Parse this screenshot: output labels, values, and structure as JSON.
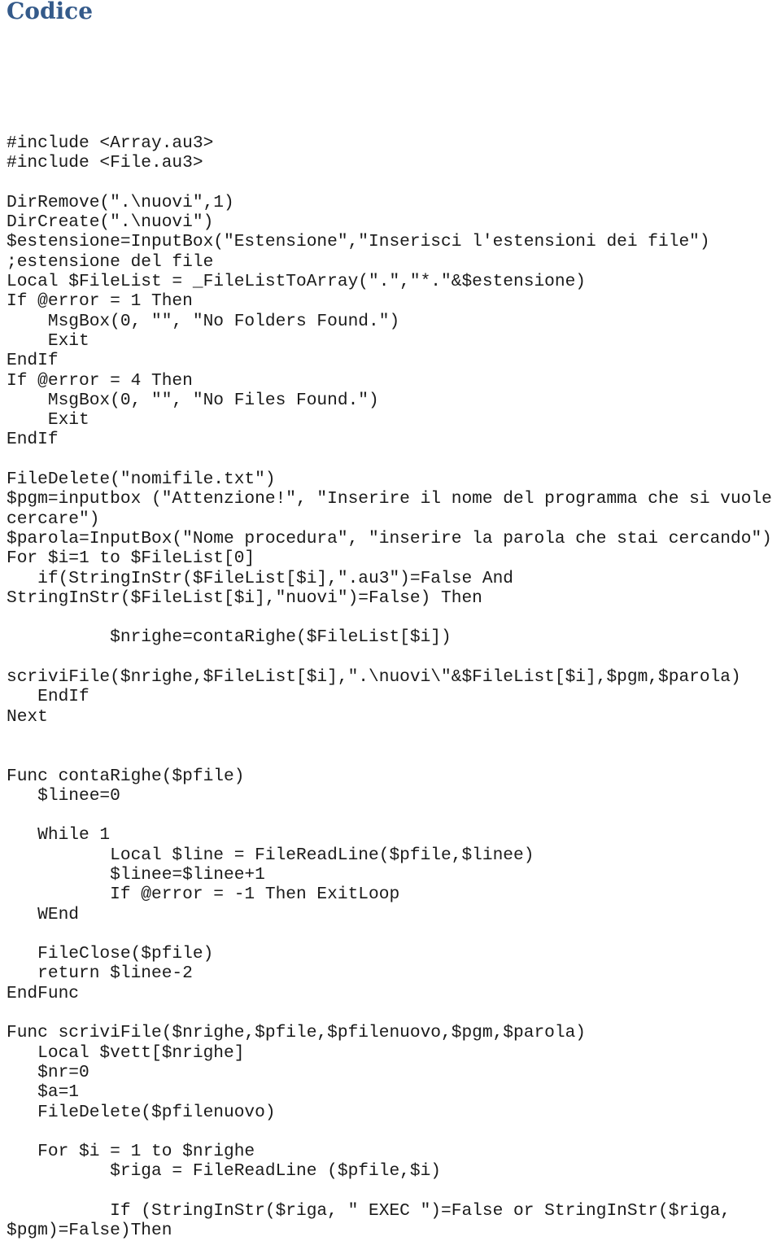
{
  "document": {
    "heading": "Codice",
    "code_lines": [
      "#include <Array.au3>",
      "#include <File.au3>",
      "",
      "DirRemove(\".\\nuovi\",1)",
      "DirCreate(\".\\nuovi\")",
      "$estensione=InputBox(\"Estensione\",\"Inserisci l'estensioni dei file\")",
      ";estensione del file",
      "Local $FileList = _FileListToArray(\".\",\"*.\"&$estensione)",
      "If @error = 1 Then",
      "    MsgBox(0, \"\", \"No Folders Found.\")",
      "    Exit",
      "EndIf",
      "If @error = 4 Then",
      "    MsgBox(0, \"\", \"No Files Found.\")",
      "    Exit",
      "EndIf",
      "",
      "FileDelete(\"nomifile.txt\")",
      "$pgm=inputbox (\"Attenzione!\", \"Inserire il nome del programma che si vuole",
      "cercare\")",
      "$parola=InputBox(\"Nome procedura\", \"inserire la parola che stai cercando\")",
      "For $i=1 to $FileList[0]",
      "   if(StringInStr($FileList[$i],\".au3\")=False And",
      "StringInStr($FileList[$i],\"nuovi\")=False) Then",
      "",
      "          $nrighe=contaRighe($FileList[$i])",
      "",
      "scriviFile($nrighe,$FileList[$i],\".\\nuovi\\\"&$FileList[$i],$pgm,$parola)",
      "   EndIf",
      "Next",
      "",
      "",
      "Func contaRighe($pfile)",
      "   $linee=0",
      "",
      "   While 1",
      "          Local $line = FileReadLine($pfile,$linee)",
      "          $linee=$linee+1",
      "          If @error = -1 Then ExitLoop",
      "   WEnd",
      "",
      "   FileClose($pfile)",
      "   return $linee-2",
      "EndFunc",
      "",
      "Func scriviFile($nrighe,$pfile,$pfilenuovo,$pgm,$parola)",
      "   Local $vett[$nrighe]",
      "   $nr=0",
      "   $a=1",
      "   FileDelete($pfilenuovo)",
      "",
      "   For $i = 1 to $nrighe",
      "          $riga = FileReadLine ($pfile,$i)",
      "",
      "          If (StringInStr($riga, \" EXEC \")=False or StringInStr($riga,",
      "$pgm)=False)Then"
    ]
  }
}
